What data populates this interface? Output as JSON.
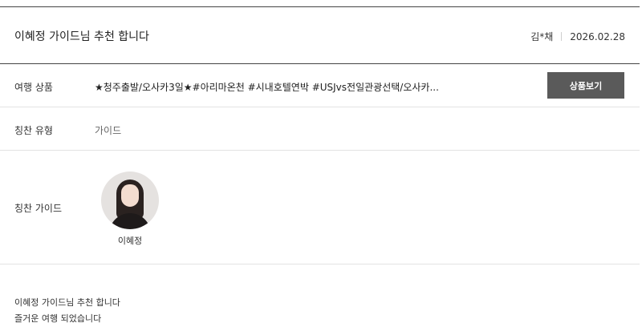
{
  "review": {
    "title": "이혜정 가이드님 추천 합니다",
    "author": "김*채",
    "date": "2026.02.28",
    "product": {
      "label": "여행 상품",
      "value": "★청주출발/오사카3일★#아리마온천 #시내호텔연박 #USJvs전일관광선택/오사카...",
      "button_label": "상품보기"
    },
    "praise_type": {
      "label": "칭찬 유형",
      "value": "가이드"
    },
    "praise_guide": {
      "label": "칭찬 가이드",
      "guide_name": "이혜정"
    },
    "body_lines": [
      "이혜정 가이드님 추천 합니다",
      "즐거운 여행 되었습니다"
    ]
  }
}
